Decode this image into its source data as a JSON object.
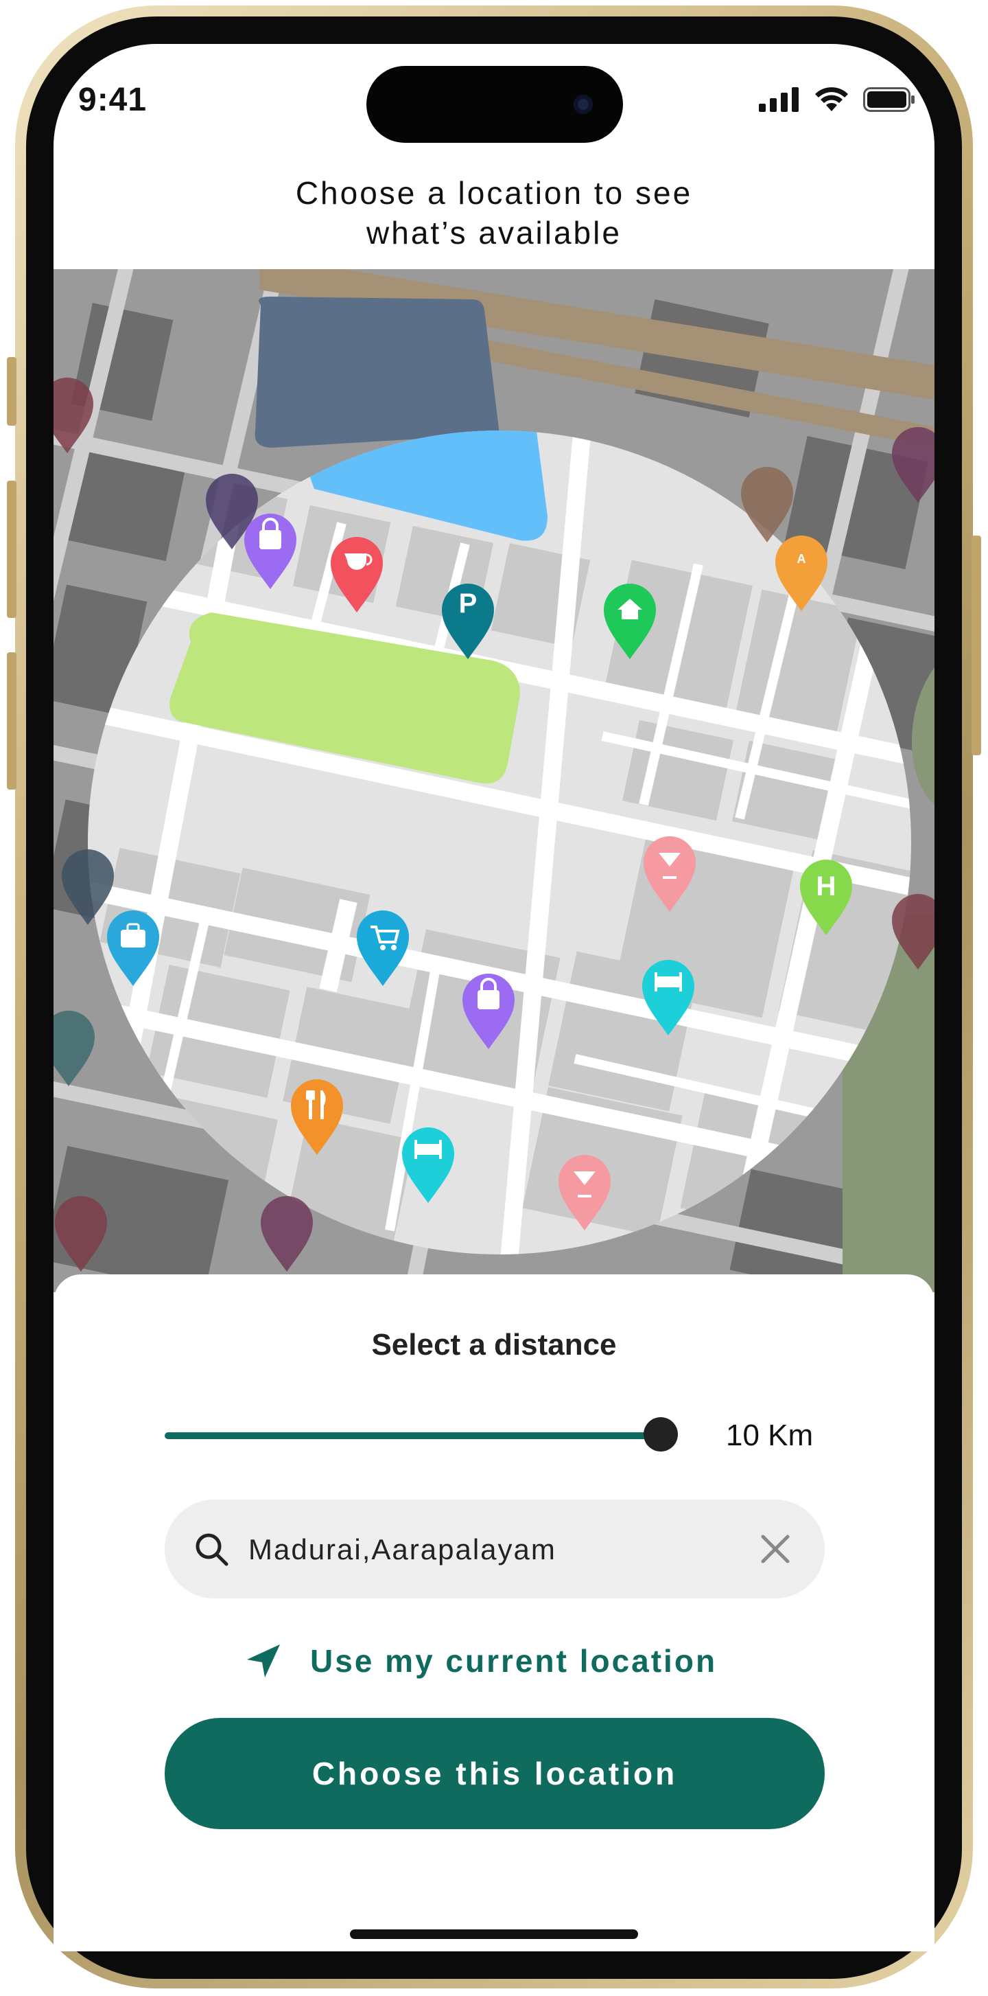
{
  "status_bar": {
    "time": "9:41"
  },
  "header": {
    "title_line1": "Choose  a location to see",
    "title_line2": "what’s available"
  },
  "map": {
    "pins": [
      {
        "icon": "bag-icon",
        "color": "#9b6cf2"
      },
      {
        "icon": "coffee-icon",
        "color": "#f2525e"
      },
      {
        "icon": "parking-icon",
        "color": "#0b7a8a",
        "label": "P"
      },
      {
        "icon": "home-icon",
        "color": "#1ec95a"
      },
      {
        "icon": "atm-icon",
        "color": "#f4a03a"
      },
      {
        "icon": "cocktail-icon",
        "color": "#f59aa0"
      },
      {
        "icon": "hospital-icon",
        "color": "#86d94a",
        "label": "H"
      },
      {
        "icon": "briefcase-icon",
        "color": "#2aa8dc"
      },
      {
        "icon": "cart-icon",
        "color": "#1aa9d9"
      },
      {
        "icon": "bag-icon",
        "color": "#9b6cf2"
      },
      {
        "icon": "hotel-icon",
        "color": "#1ccfd9"
      },
      {
        "icon": "restaurant-icon",
        "color": "#f3922a"
      },
      {
        "icon": "hotel-icon",
        "color": "#1ccfd9"
      },
      {
        "icon": "cocktail-icon",
        "color": "#f59aa0"
      }
    ]
  },
  "distance": {
    "title": "Select a distance",
    "value": "10 Km",
    "slider_fraction": 1.0
  },
  "search": {
    "value": "Madurai,Aarapalayam",
    "placeholder": ""
  },
  "use_location": {
    "label": "Use my current location"
  },
  "cta": {
    "label": "Choose this location"
  },
  "colors": {
    "accent": "#0e6b5e",
    "search_bg": "#eeeeee"
  }
}
